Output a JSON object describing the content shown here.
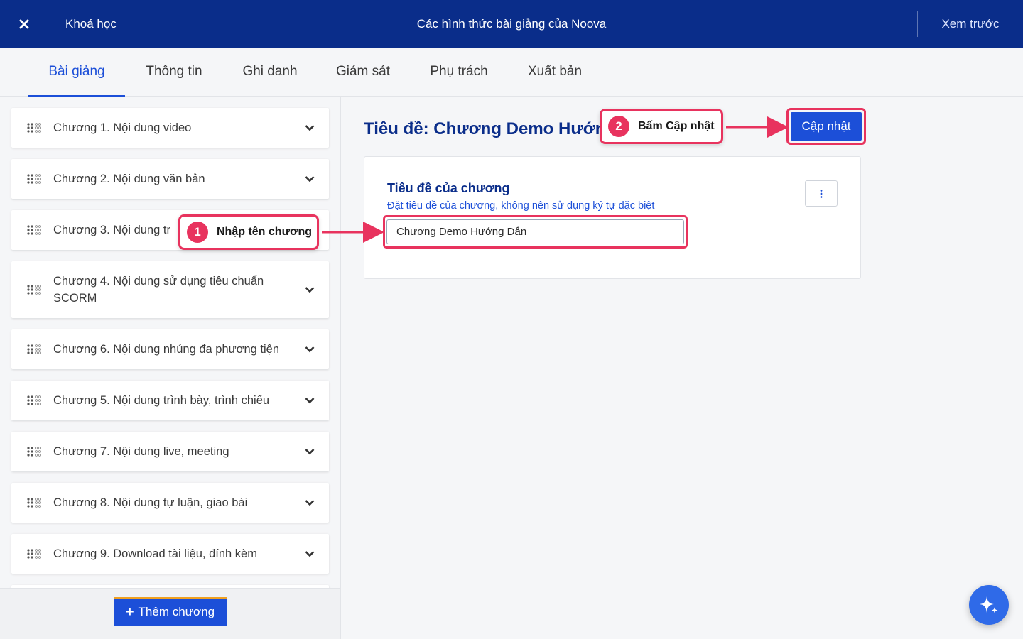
{
  "topbar": {
    "close_icon": "close-icon",
    "course_label": "Khoá học",
    "title": "Các hình thức bài giảng của Noova",
    "preview_label": "Xem trước"
  },
  "tabs": [
    {
      "label": "Bài giảng",
      "active": true
    },
    {
      "label": "Thông tin",
      "active": false
    },
    {
      "label": "Ghi danh",
      "active": false
    },
    {
      "label": "Giám sát",
      "active": false
    },
    {
      "label": "Phụ trách",
      "active": false
    },
    {
      "label": "Xuất bản",
      "active": false
    }
  ],
  "sidebar": {
    "chapters": [
      {
        "label": "Chương 1. Nội dung video"
      },
      {
        "label": "Chương 2. Nội dung văn bản"
      },
      {
        "label": "Chương 3. Nội dung tr"
      },
      {
        "label": "Chương 4. Nội dung sử dụng tiêu chuẩn SCORM"
      },
      {
        "label": "Chương 6. Nội dung nhúng đa phương tiện"
      },
      {
        "label": "Chương 5. Nội dung trình bày, trình chiếu"
      },
      {
        "label": "Chương 7. Nội dung live, meeting"
      },
      {
        "label": "Chương 8. Nội dung tự luận, giao bài"
      },
      {
        "label": "Chương 9. Download tài liệu, đính kèm"
      }
    ],
    "add_button_label": "Thêm chương"
  },
  "main": {
    "title": "Tiêu đề: Chương Demo Hướng Dẫn",
    "update_button_label": "Cập nhật",
    "card": {
      "heading": "Tiêu đề của chương",
      "hint": "Đặt tiêu đề của chương, không nên sử dụng ký tự đặc biệt",
      "input_value": "Chương Demo Hướng Dẫn"
    }
  },
  "callouts": [
    {
      "number": "1",
      "text": "Nhập tên chương"
    },
    {
      "number": "2",
      "text": "Bấm Cập nhật"
    }
  ],
  "colors": {
    "topbar": "#0a2d8a",
    "accent": "#1c4fd8",
    "annotation": "#e8335e"
  }
}
